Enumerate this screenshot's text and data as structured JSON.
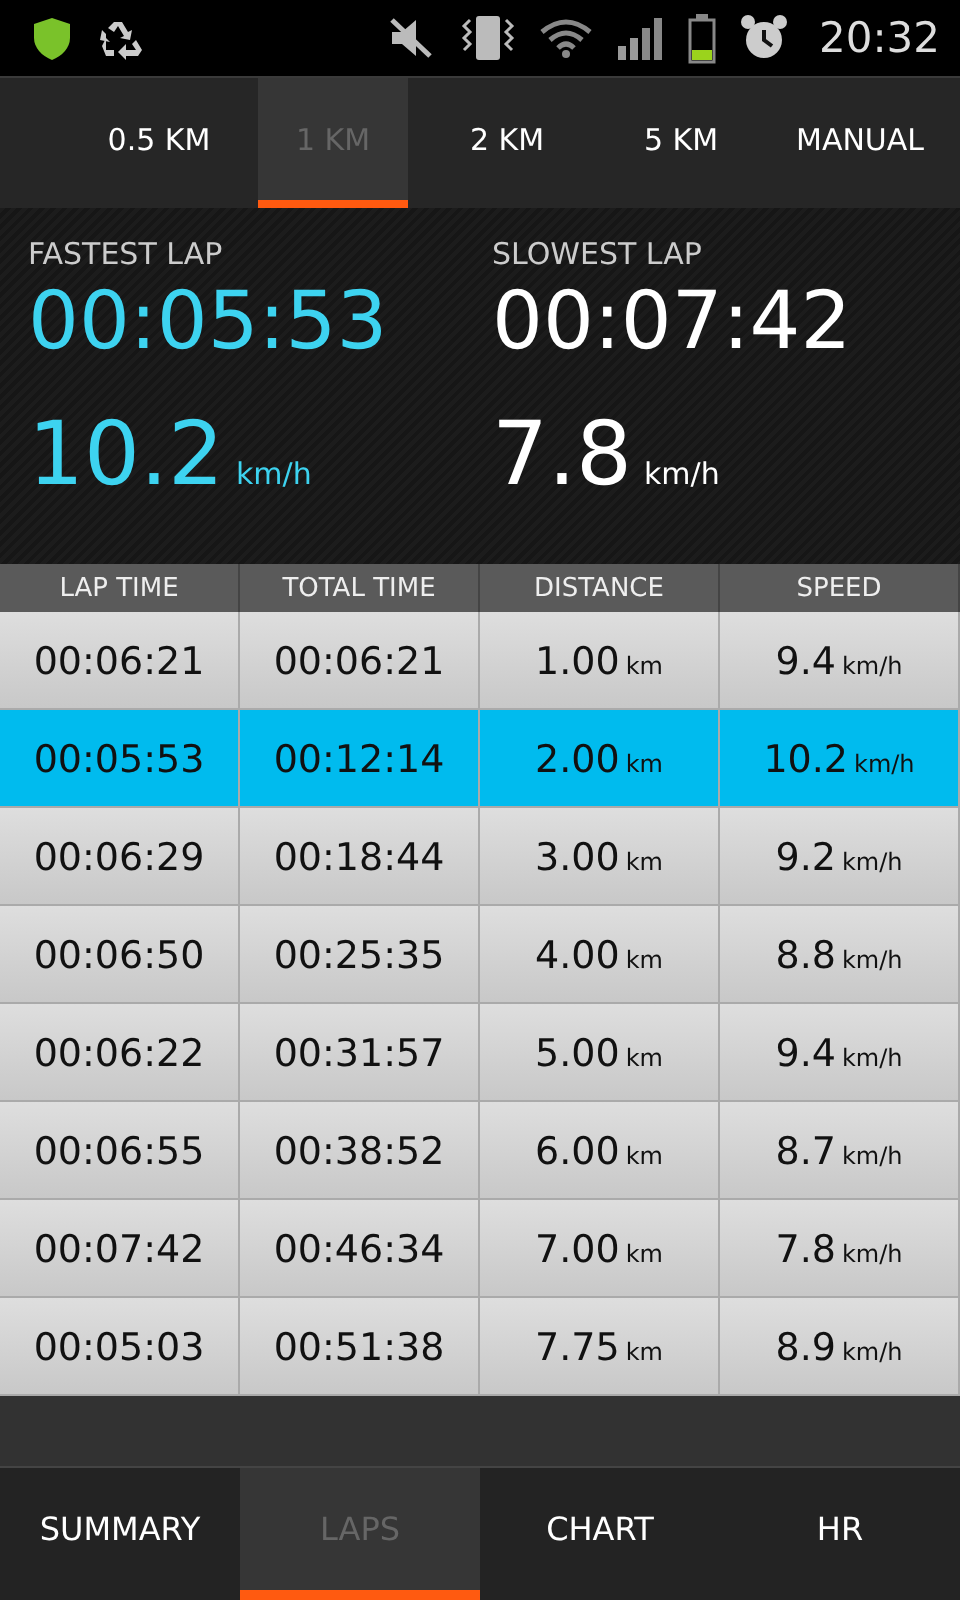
{
  "status_bar": {
    "time": "20:32"
  },
  "distance_tabs": [
    {
      "label": "0.5 KM",
      "selected": false
    },
    {
      "label": "1 KM",
      "selected": true
    },
    {
      "label": "2 KM",
      "selected": false
    },
    {
      "label": "5 KM",
      "selected": false
    },
    {
      "label": "MANUAL",
      "selected": false
    }
  ],
  "stats": [
    {
      "title": "FASTEST LAP",
      "time": "00:05:53",
      "speed": "10.2",
      "unit": "km/h",
      "color": "#3dd3f0"
    },
    {
      "title": "SLOWEST LAP",
      "time": "00:07:42",
      "speed": "7.8",
      "unit": "km/h",
      "color": "#ffffff"
    }
  ],
  "table": {
    "columns": [
      "LAP TIME",
      "TOTAL TIME",
      "DISTANCE",
      "SPEED"
    ],
    "rows": [
      {
        "selected": false,
        "cells": [
          {
            "value": "00:06:21"
          },
          {
            "value": "00:06:21"
          },
          {
            "value": "1.00",
            "unit": "km"
          },
          {
            "value": "9.4",
            "unit": "km/h"
          }
        ]
      },
      {
        "selected": true,
        "cells": [
          {
            "value": "00:05:53"
          },
          {
            "value": "00:12:14"
          },
          {
            "value": "2.00",
            "unit": "km"
          },
          {
            "value": "10.2",
            "unit": "km/h"
          }
        ]
      },
      {
        "selected": false,
        "cells": [
          {
            "value": "00:06:29"
          },
          {
            "value": "00:18:44"
          },
          {
            "value": "3.00",
            "unit": "km"
          },
          {
            "value": "9.2",
            "unit": "km/h"
          }
        ]
      },
      {
        "selected": false,
        "cells": [
          {
            "value": "00:06:50"
          },
          {
            "value": "00:25:35"
          },
          {
            "value": "4.00",
            "unit": "km"
          },
          {
            "value": "8.8",
            "unit": "km/h"
          }
        ]
      },
      {
        "selected": false,
        "cells": [
          {
            "value": "00:06:22"
          },
          {
            "value": "00:31:57"
          },
          {
            "value": "5.00",
            "unit": "km"
          },
          {
            "value": "9.4",
            "unit": "km/h"
          }
        ]
      },
      {
        "selected": false,
        "cells": [
          {
            "value": "00:06:55"
          },
          {
            "value": "00:38:52"
          },
          {
            "value": "6.00",
            "unit": "km"
          },
          {
            "value": "8.7",
            "unit": "km/h"
          }
        ]
      },
      {
        "selected": false,
        "cells": [
          {
            "value": "00:07:42"
          },
          {
            "value": "00:46:34"
          },
          {
            "value": "7.00",
            "unit": "km"
          },
          {
            "value": "7.8",
            "unit": "km/h"
          }
        ]
      },
      {
        "selected": false,
        "cells": [
          {
            "value": "00:05:03"
          },
          {
            "value": "00:51:38"
          },
          {
            "value": "7.75",
            "unit": "km"
          },
          {
            "value": "8.9",
            "unit": "km/h"
          }
        ]
      }
    ]
  },
  "bottom_tabs": [
    {
      "label": "SUMMARY",
      "selected": false
    },
    {
      "label": "LAPS",
      "selected": true
    },
    {
      "label": "CHART",
      "selected": false
    },
    {
      "label": "HR",
      "selected": false
    }
  ]
}
